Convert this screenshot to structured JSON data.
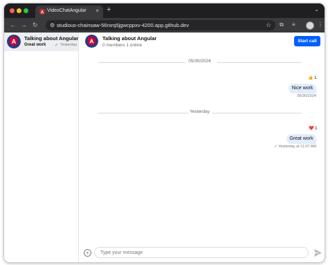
{
  "browser": {
    "tab_title": "VideoChatAngular",
    "tab_close_glyph": "×",
    "new_tab_glyph": "+",
    "url": "studious-chainsaw-56rxrq5jgwcppxv-4200.app.github.dev"
  },
  "sidebar": {
    "channels": [
      {
        "name": "Talking about Angular",
        "last_message": "Great work",
        "time": "Yesterday",
        "read_icon": "double-check-icon"
      }
    ]
  },
  "channel_header": {
    "title": "Talking about Angular",
    "subtitle": "0 members 1 online",
    "start_call_label": "Start call"
  },
  "messages": {
    "date_separators": [
      "05/30/2024",
      "Yesterday"
    ],
    "items": [
      {
        "text": "Nice work",
        "reaction_emoji": "👍",
        "reaction_count": "1",
        "meta": "05/30/2024"
      },
      {
        "text": "Great work",
        "reaction_emoji": "❤️",
        "reaction_count": "1",
        "meta": "Yesterday at 11:07 AM"
      }
    ]
  },
  "composer": {
    "placeholder": "Type your message"
  },
  "colors": {
    "accent": "#005fff",
    "bubble": "#e1ecfc",
    "angular_red": "#dd0031",
    "angular_navy": "#2b3a80"
  }
}
